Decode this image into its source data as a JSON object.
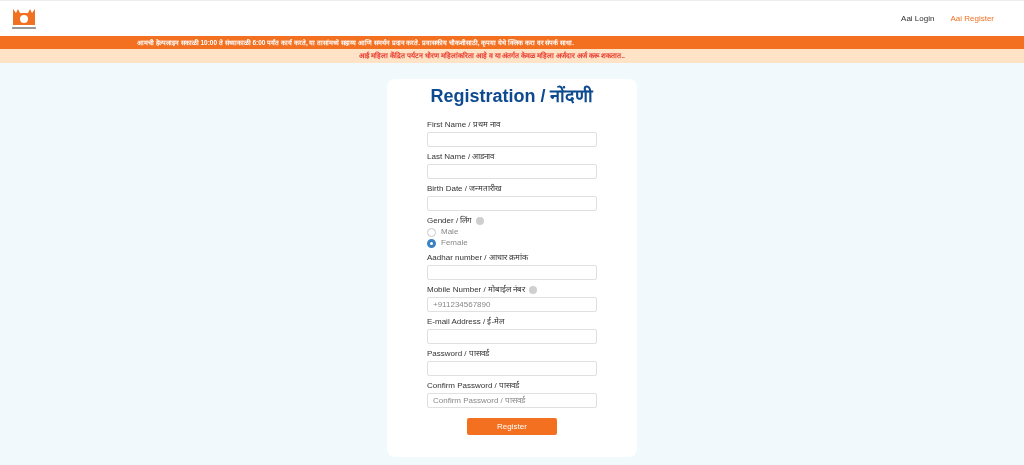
{
  "nav": [
    {
      "label": "Aai Login",
      "selected": false
    },
    {
      "label": "Aai Register",
      "selected": true
    }
  ],
  "notice": "आमची हेल्पलाइन सकाळी 10:00 ते संध्याकाळी 6:00 पर्यंत कार्य करते, या तासांमध्ये सहाय्य आणि समर्थन प्रदान करते. प्रवासकीय चौकशीसाठी, कृपया **येथे क्लिक** करा वर संपर्क साधा.",
  "alert": "आई महिला केंद्रित पर्यटन धोरण महिलांकरिता आहे व या अंतर्गत केवळ महिला अर्जदार अर्ज करू शकतात..",
  "title": "Registration / नोंदणी",
  "fields": [
    {
      "kind": "text",
      "label": "First Name / प्रथम नाव"
    },
    {
      "kind": "text",
      "label": "Last Name / आडनाव"
    },
    {
      "kind": "text",
      "label": "Birth Date / जन्मतारीख"
    },
    {
      "kind": "radio",
      "label": "Gender / लिंग",
      "help": true,
      "options": [
        {
          "label": "Male",
          "selected": false
        },
        {
          "label": "Female",
          "selected": true
        }
      ]
    },
    {
      "kind": "text",
      "label": "Aadhar number / आधार क्रमांक"
    },
    {
      "kind": "text",
      "label": "Mobile Number / मोबाईल नंबर",
      "help": true,
      "placeholder": "+911234567890"
    },
    {
      "kind": "text",
      "label": "E-mail Address / ई-मेल"
    },
    {
      "kind": "text",
      "label": "Password / पासवर्ड"
    },
    {
      "kind": "text",
      "label": "Confirm Password / पासवर्ड",
      "placeholder": "Confirm Password / पासवर्ड"
    }
  ],
  "submit": "Register"
}
